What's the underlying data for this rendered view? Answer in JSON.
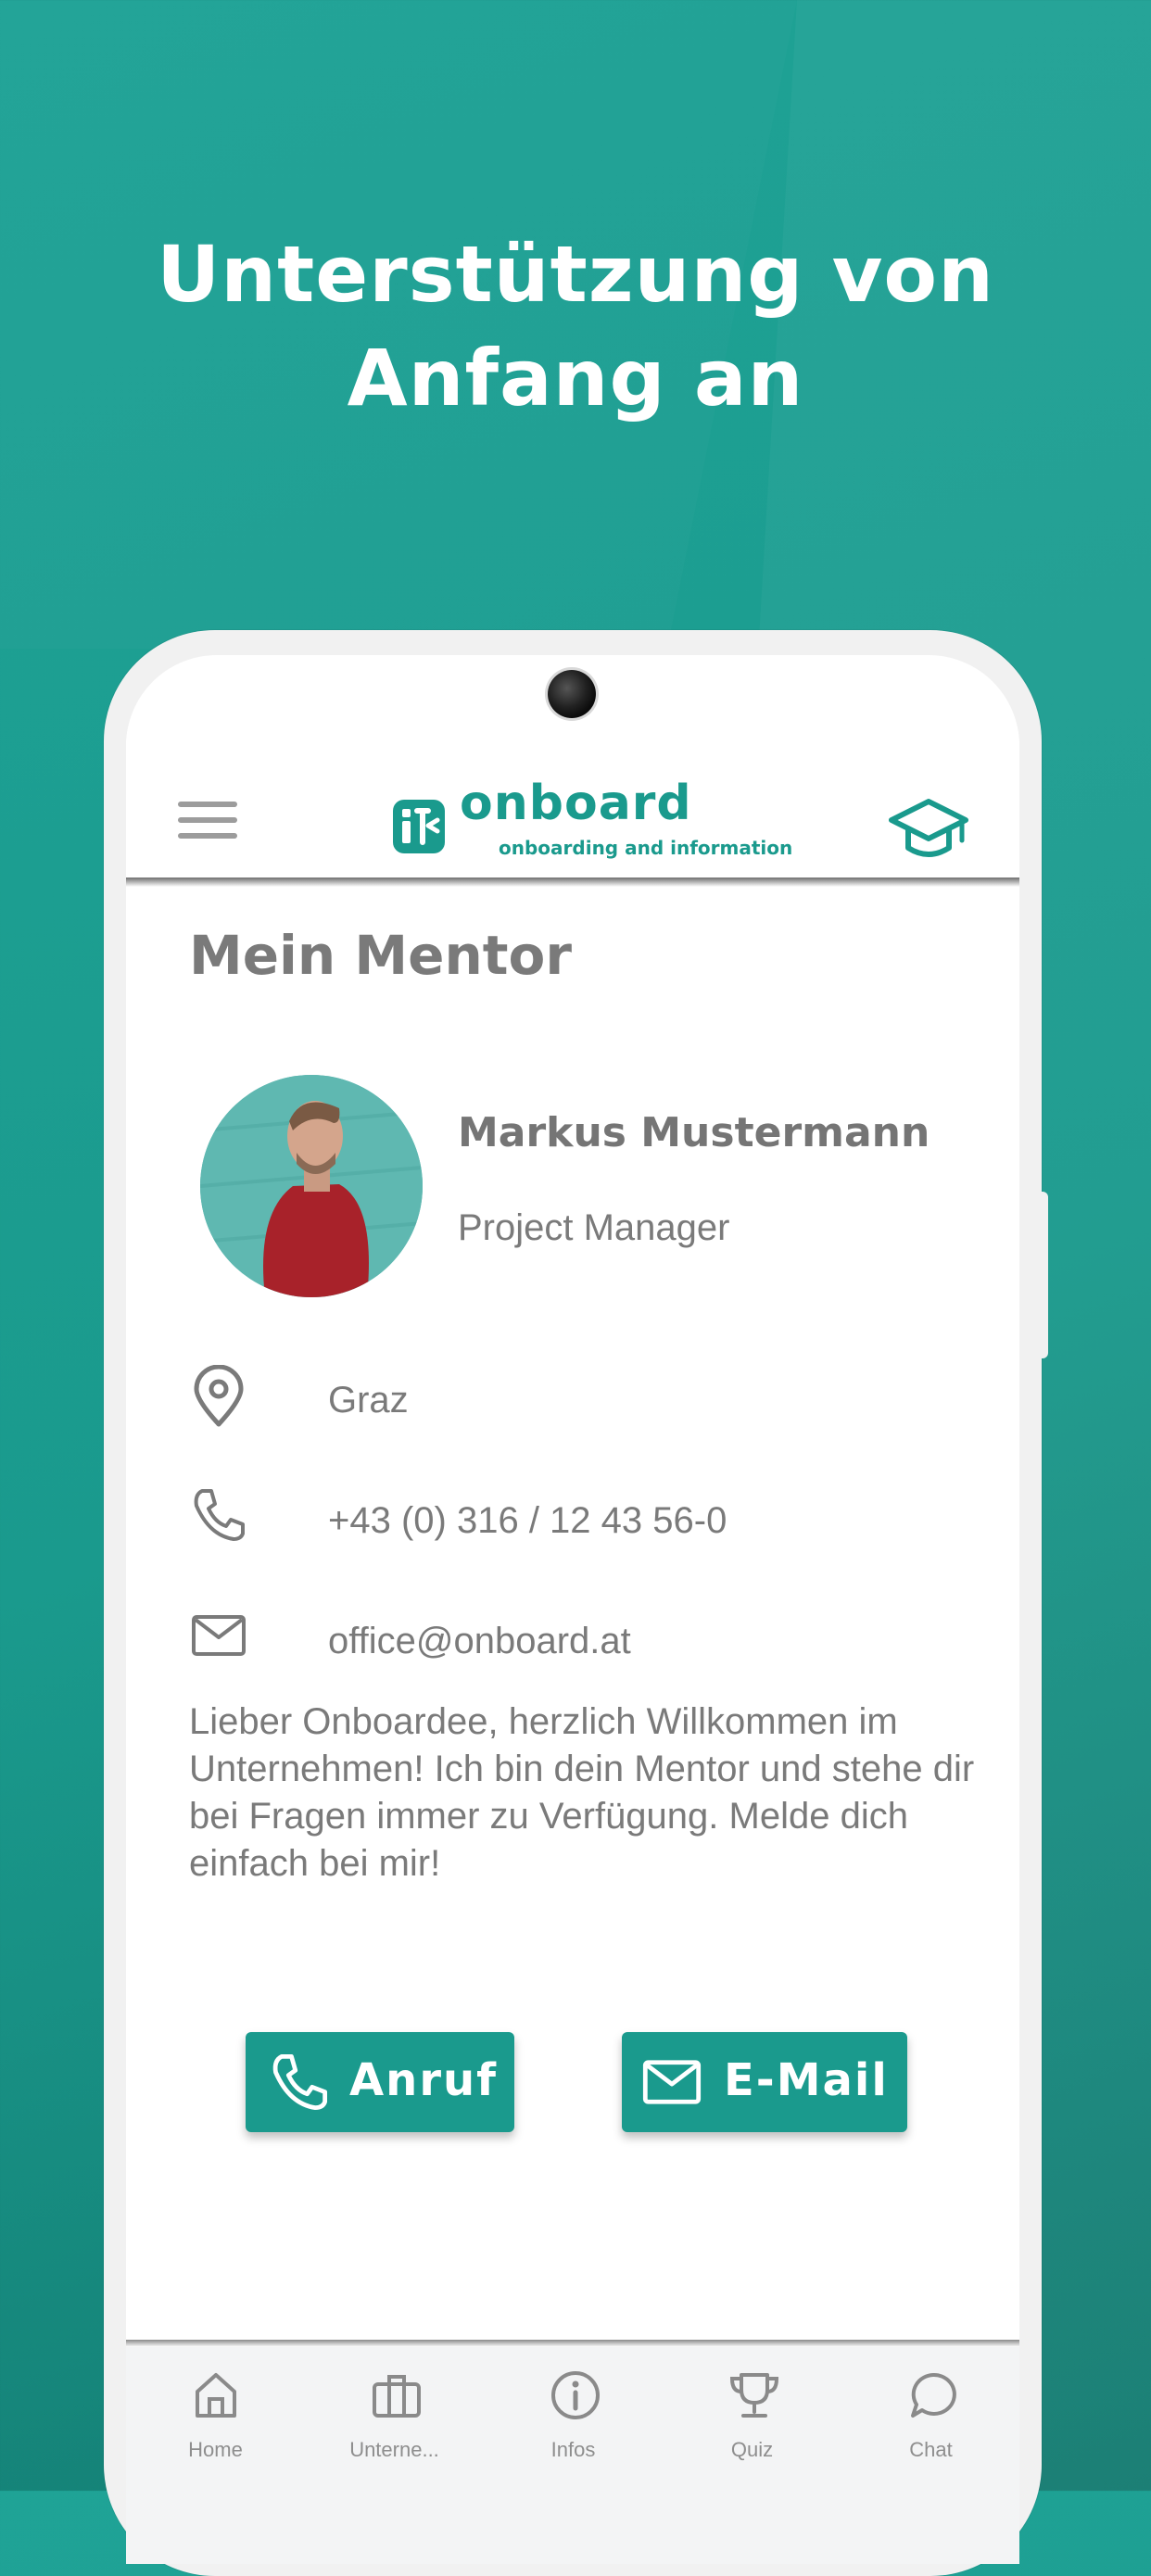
{
  "headline": {
    "line1": "Unterstützung von",
    "line2": "Anfang an"
  },
  "app": {
    "logo_text": "onboard",
    "logo_subtitle": "onboarding and information",
    "brand_color": "#1a9a8d"
  },
  "page": {
    "title": "Mein Mentor",
    "mentor": {
      "name": "Markus Mustermann",
      "role": "Project Manager"
    },
    "contact": {
      "location": "Graz",
      "phone": "+43 (0) 316 / 12 43 56-0",
      "email": "office@onboard.at"
    },
    "message": "Lieber Onboardee, herzlich Willkommen im Unternehmen! Ich bin dein Mentor und stehe dir bei Fragen immer zu Verfügung. Melde dich einfach bei mir!",
    "buttons": {
      "call": "Anruf",
      "email": "E-Mail"
    }
  },
  "nav": [
    {
      "label": "Home",
      "icon": "home-icon"
    },
    {
      "label": "Unterne...",
      "icon": "briefcase-icon"
    },
    {
      "label": "Infos",
      "icon": "info-icon"
    },
    {
      "label": "Quiz",
      "icon": "trophy-icon"
    },
    {
      "label": "Chat",
      "icon": "chat-icon"
    }
  ]
}
